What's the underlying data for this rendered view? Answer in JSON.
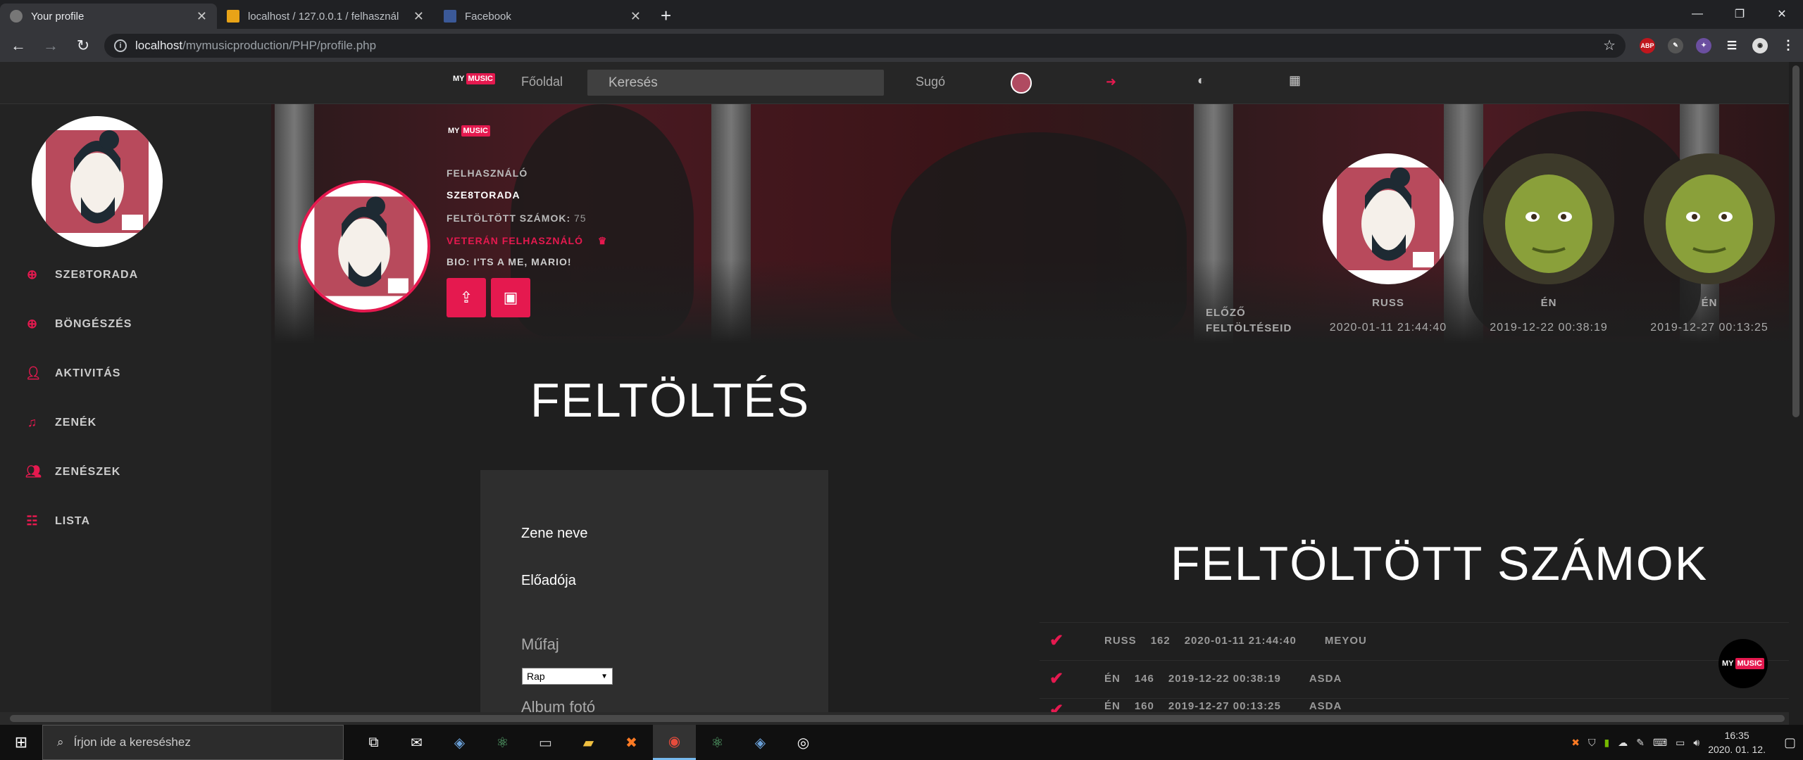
{
  "browser": {
    "tabs": [
      {
        "title": "Your profile",
        "active": true
      },
      {
        "title": "localhost / 127.0.0.1 / felhasznál",
        "active": false
      },
      {
        "title": "Facebook",
        "active": false
      }
    ],
    "url_host": "localhost",
    "url_path": "/mymusicproduction/PHP/profile.php"
  },
  "logo": {
    "my": "MY",
    "music": "MUSIC"
  },
  "nav": {
    "home": "Főoldal",
    "search_placeholder": "Keresés",
    "help": "Sugó"
  },
  "sidebar": {
    "items": [
      {
        "label": "SZE8TORADA",
        "icon": "plus-circle-icon"
      },
      {
        "label": "BÖNGÉSZÉS",
        "icon": "plus-circle-icon"
      },
      {
        "label": "AKTIVITÁS",
        "icon": "user-icon"
      },
      {
        "label": "ZENÉK",
        "icon": "music-note-icon"
      },
      {
        "label": "ZENÉSZEK",
        "icon": "users-icon"
      },
      {
        "label": "LISTA",
        "icon": "list-icon"
      }
    ]
  },
  "profile": {
    "role_label": "FELHASZNÁLÓ",
    "username": "SZE8TORADA",
    "uploaded_label": "FELTÖLTÖTT SZÁMOK:",
    "uploaded_count": "75",
    "veteran": "VETERÁN FELHASZNÁLÓ",
    "bio": "BIO: I'TS A ME, MARIO!"
  },
  "previous": {
    "label_line1": "ELŐZŐ",
    "label_line2": "FELTÖLTÉSEID",
    "items": [
      {
        "name": "RUSS",
        "date": "2020-01-11 21:44:40"
      },
      {
        "name": "ÉN",
        "date": "2019-12-22 00:38:19"
      },
      {
        "name": "ÉN",
        "date": "2019-12-27 00:13:25"
      }
    ]
  },
  "upload": {
    "heading": "FELTÖLTÉS",
    "song_name": "Zene neve",
    "artist": "Előadója",
    "genre": "Műfaj",
    "genre_value": "Rap",
    "album_photo": "Album fotó"
  },
  "tracks": {
    "heading": "FELTÖLTÖTT SZÁMOK",
    "rows": [
      {
        "name": "RUSS",
        "id": "162",
        "date": "2020-01-11 21:44:40",
        "title": "MEYOU"
      },
      {
        "name": "ÉN",
        "id": "146",
        "date": "2019-12-22 00:38:19",
        "title": "ASDA"
      },
      {
        "name": "ÉN",
        "id": "160",
        "date": "2019-12-27 00:13:25",
        "title": "ASDA"
      }
    ]
  },
  "taskbar": {
    "search_placeholder": "Írjon ide a kereséshez",
    "time": "16:35",
    "date": "2020. 01. 12."
  },
  "colors": {
    "accent": "#e5194f",
    "background": "#1f1f1f"
  }
}
